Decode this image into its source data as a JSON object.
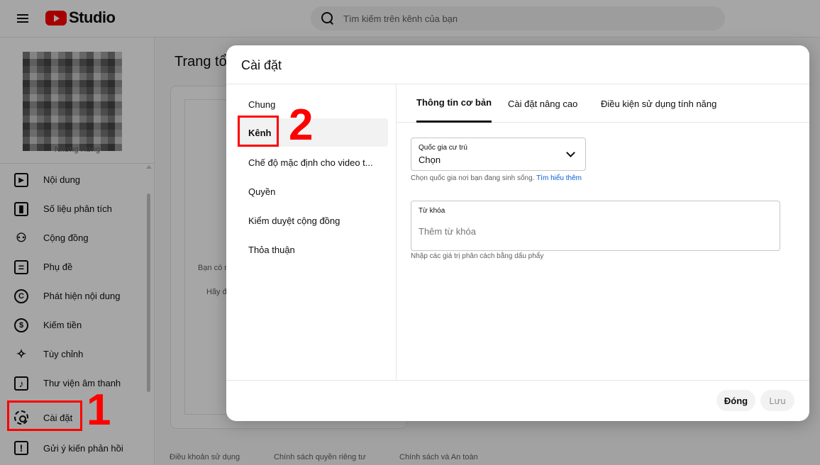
{
  "header": {
    "logo_text": "Studio",
    "search_placeholder": "Tìm kiếm trên kênh của bạn"
  },
  "sidebar": {
    "channel_name": "Nhưng Hưng",
    "items": [
      {
        "label": "Nội dung",
        "icon": "content-icon"
      },
      {
        "label": "Số liệu phân tích",
        "icon": "analytics-icon"
      },
      {
        "label": "Cộng đồng",
        "icon": "community-icon"
      },
      {
        "label": "Phụ đề",
        "icon": "subtitles-icon"
      },
      {
        "label": "Phát hiện nội dung",
        "icon": "copyright-icon"
      },
      {
        "label": "Kiếm tiền",
        "icon": "monetization-icon"
      },
      {
        "label": "Tùy chỉnh",
        "icon": "customization-icon"
      },
      {
        "label": "Thư viện âm thanh",
        "icon": "audio-library-icon"
      }
    ],
    "settings_label": "Cài đặt",
    "feedback_label": "Gửi ý kiến phản hồi"
  },
  "background": {
    "title": "Trang tổ",
    "text1": "Bạn có n",
    "text2": "Hãy đ",
    "footer_links": [
      "Điều khoản sử dụng",
      "Chính sách quyền riêng tư",
      "Chính sách và An toàn"
    ]
  },
  "annotations": {
    "step1": "1",
    "step2": "2",
    "highlight_color": "#ff0000"
  },
  "dialog": {
    "title": "Cài đặt",
    "nav": [
      {
        "label": "Chung",
        "active": false
      },
      {
        "label": "Kênh",
        "active": true
      },
      {
        "label": "Chế độ mặc định cho video t...",
        "active": false
      },
      {
        "label": "Quyền",
        "active": false
      },
      {
        "label": "Kiểm duyệt cộng đồng",
        "active": false
      },
      {
        "label": "Thỏa thuận",
        "active": false
      }
    ],
    "tabs": [
      {
        "label": "Thông tin cơ bản",
        "active": true
      },
      {
        "label": "Cài đặt nâng cao",
        "active": false
      },
      {
        "label": "Điều kiện sử dụng tính năng",
        "active": false
      }
    ],
    "country": {
      "label": "Quốc gia cư trú",
      "value": "Chọn",
      "help": "Chọn quốc gia nơi bạn đang sinh sống.",
      "help_link": "Tìm hiểu thêm"
    },
    "keywords": {
      "label": "Từ khóa",
      "placeholder": "Thêm từ khóa",
      "help": "Nhập các giá trị phân cách bằng dấu phẩy"
    },
    "buttons": {
      "close": "Đóng",
      "save": "Lưu"
    }
  }
}
